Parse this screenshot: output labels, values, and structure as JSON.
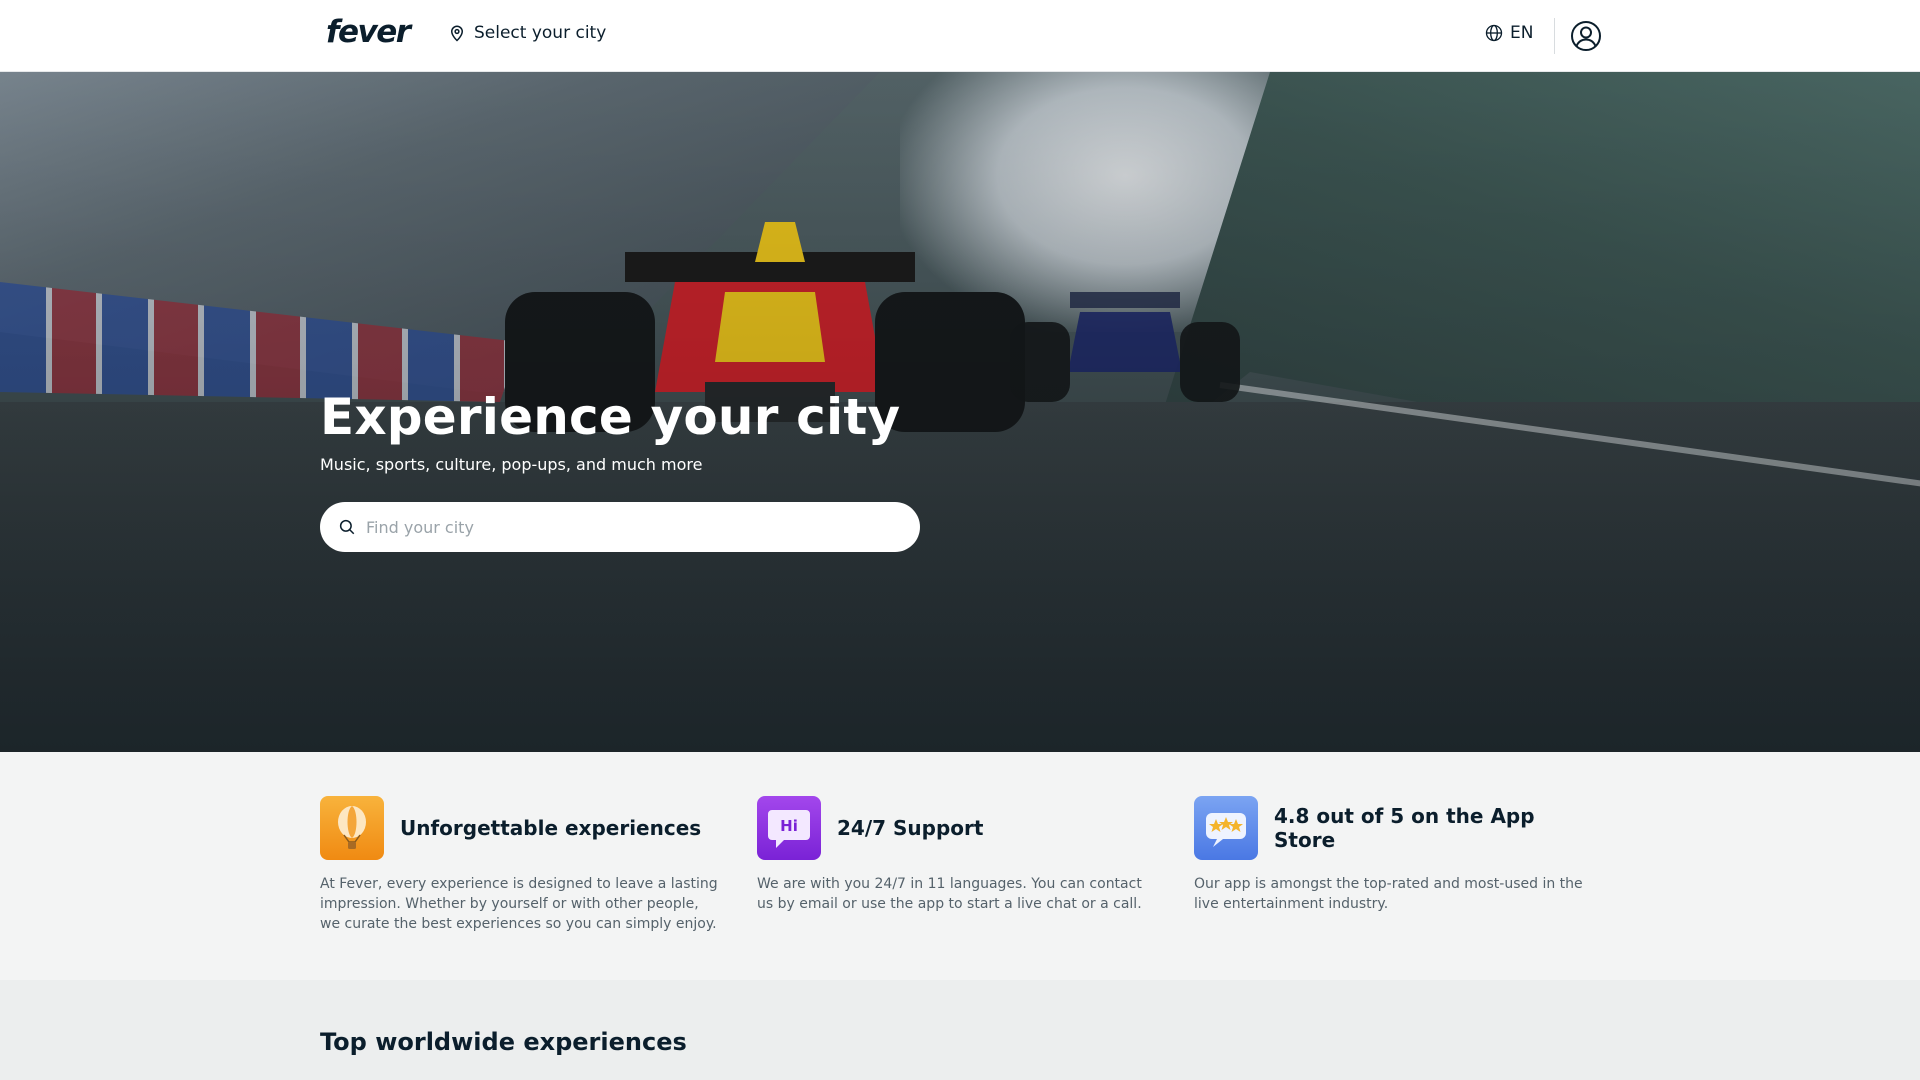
{
  "header": {
    "logo": "fever",
    "city_select_label": "Select your city",
    "language": "EN",
    "icons": {
      "location": "map-pin-icon",
      "globe": "globe-icon",
      "account": "user-account-icon"
    }
  },
  "hero": {
    "title": "Experience your city",
    "subtitle": "Music, sports, culture, pop-ups, and much more",
    "search": {
      "placeholder": "Find your city",
      "value": "",
      "icon": "search-icon"
    }
  },
  "features": [
    {
      "icon": "hot-air-balloon-icon",
      "title": "Unforgettable experiences",
      "text": "At Fever, every experience is designed to leave a lasting impression. Whether by yourself or with other people, we curate the best experiences so you can simply enjoy."
    },
    {
      "icon": "hi-chat-bubble-icon",
      "icon_text": "Hi",
      "title": "24/7 Support",
      "text": "We are with you 24/7 in 11 languages. You can contact us by email or use the app to start a live chat or a call."
    },
    {
      "icon": "star-rating-icon",
      "title": "4.8 out of 5 on the App Store",
      "text": "Our app is amongst the top-rated and most-used in the live entertainment industry."
    }
  ],
  "top_section": {
    "title": "Top worldwide experiences"
  },
  "colors": {
    "text_primary": "#0b1e2c",
    "text_secondary": "#55626b",
    "feature_bg": "#f3f4f4",
    "icon_orange": "#f59a1e",
    "icon_purple": "#8a2be2",
    "icon_blue": "#4f7ee8"
  }
}
